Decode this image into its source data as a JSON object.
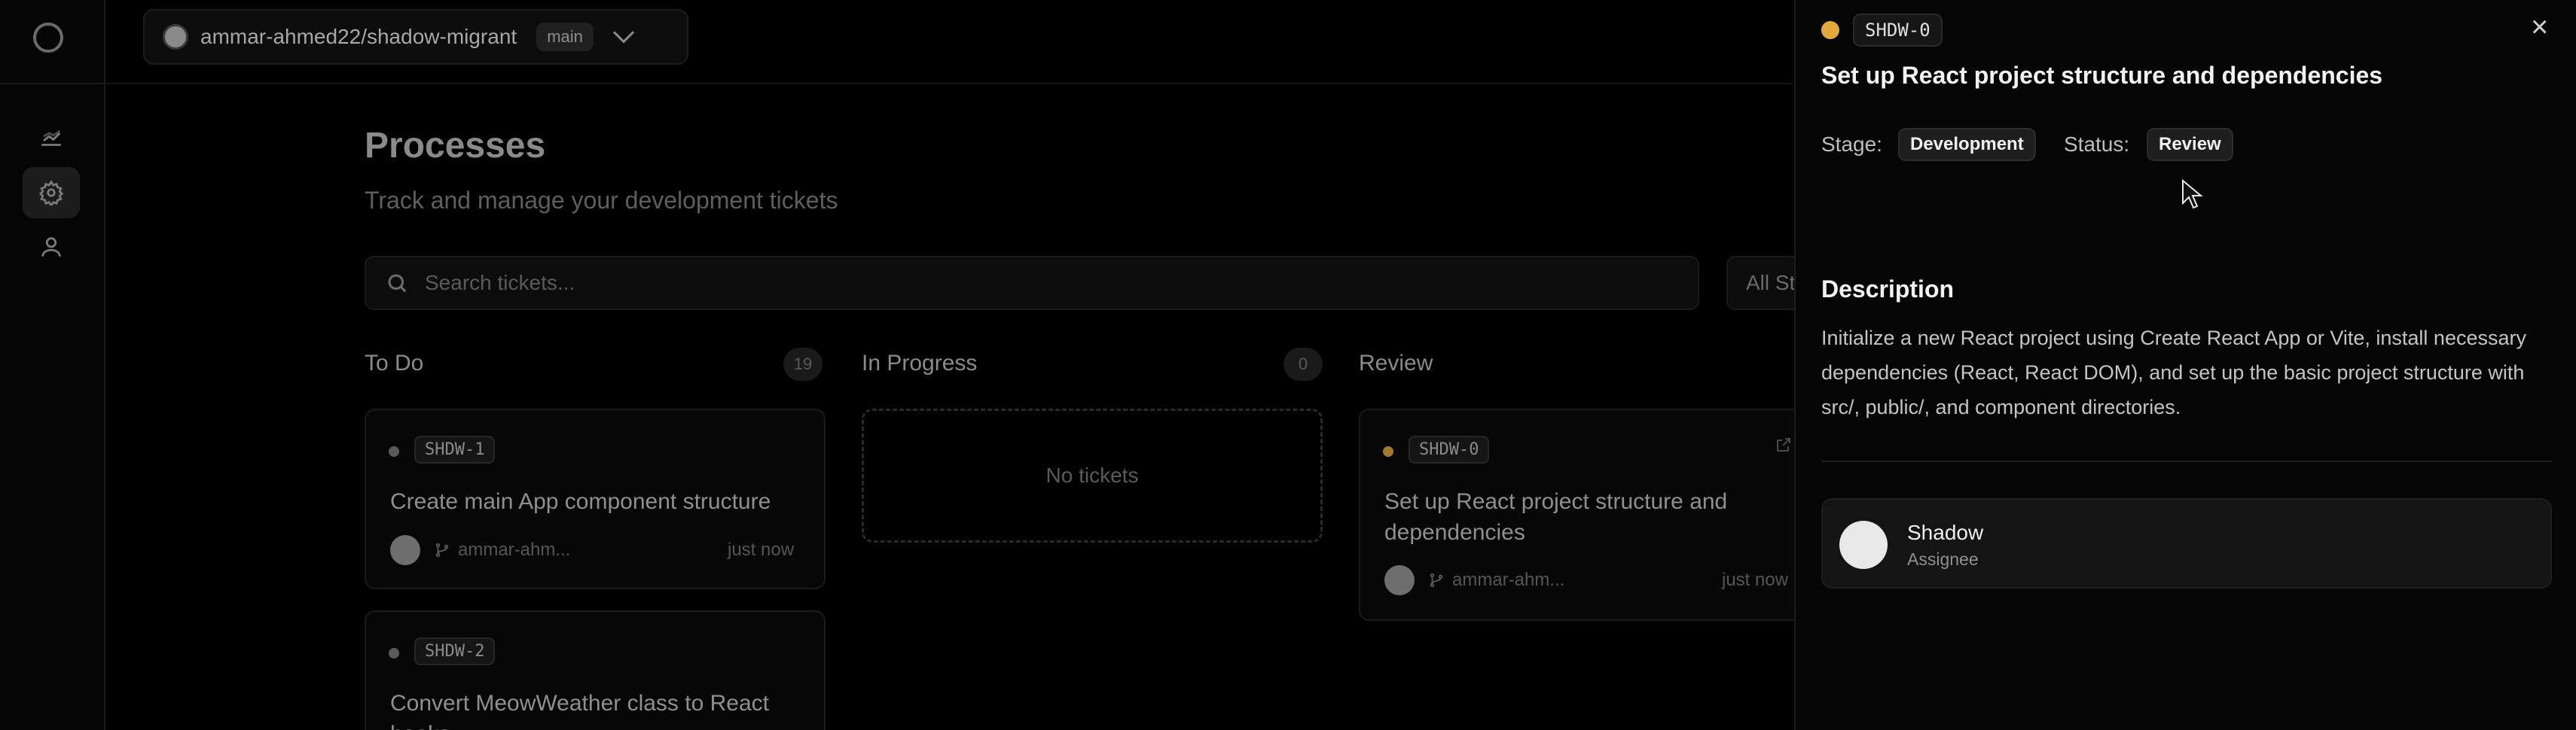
{
  "repo": {
    "name": "ammar-ahmed22/shadow-migrant",
    "branch": "main"
  },
  "page": {
    "title": "Processes",
    "subtitle": "Track and manage your development tickets"
  },
  "search": {
    "placeholder": "Search tickets..."
  },
  "filter": {
    "label": "All St"
  },
  "columns": [
    {
      "title": "To Do",
      "count": "19"
    },
    {
      "title": "In Progress",
      "count": "0",
      "empty_text": "No tickets"
    },
    {
      "title": "Review",
      "count": ""
    }
  ],
  "cards": [
    {
      "id": "SHDW-1",
      "title": "Create main App component structure",
      "author": "ammar-ahm...",
      "time": "just now",
      "status_color": "#5a5a5a"
    },
    {
      "id": "SHDW-2",
      "title": "Convert MeowWeather class to React hooks",
      "status_color": "#5a5a5a"
    },
    {
      "id": "SHDW-0",
      "title": "Set up React project structure and dependencies",
      "author": "ammar-ahm...",
      "time": "just now",
      "status_color": "#a07a2a"
    }
  ],
  "detail": {
    "ticket_id": "SHDW-0",
    "title": "Set up React project structure and dependencies",
    "stage_label": "Stage:",
    "stage": "Development",
    "status_label": "Status:",
    "status": "Review",
    "description_heading": "Description",
    "description": "Initialize a new React project using Create React App or Vite, install necessary dependencies (React, React DOM), and set up the basic project structure with src/, public/, and component directories.",
    "assignee_name": "Shadow",
    "assignee_role": "Assignee",
    "status_color": "#e2a93b"
  },
  "icons": [
    "logo-icon",
    "chart-icon",
    "gear-icon",
    "user-icon",
    "search-icon",
    "branch-icon",
    "external-link-icon",
    "close-icon",
    "chevron-down-icon"
  ]
}
